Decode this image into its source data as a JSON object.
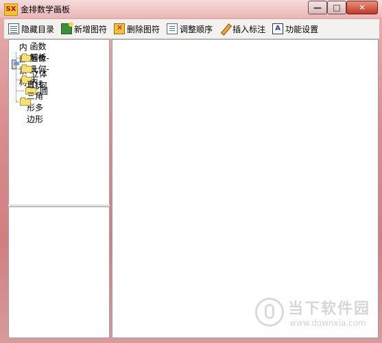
{
  "window": {
    "title": "金排数学画板",
    "app_icon_text": "SX",
    "controls": {
      "minimize": "—",
      "maximize": "□",
      "close": "✕"
    }
  },
  "toolbar": {
    "items": [
      {
        "label": "隐藏目录",
        "icon": "list-icon"
      },
      {
        "label": "新增图符",
        "icon": "add-symbol-icon"
      },
      {
        "label": "删除图符",
        "icon": "delete-symbol-icon"
      },
      {
        "label": "调整顺序",
        "icon": "reorder-icon"
      },
      {
        "label": "插入标注",
        "icon": "pencil-icon"
      },
      {
        "label": "功能设置",
        "icon": "settings-ab-icon"
      }
    ]
  },
  "tree": {
    "root": "内部素材",
    "children": [
      "函数图像-大",
      "解析几何-大",
      "立体几何",
      "圆",
      "直线三角形多边形"
    ]
  },
  "watermark": {
    "text": "当下软件园",
    "url": "www.downxia.com"
  }
}
